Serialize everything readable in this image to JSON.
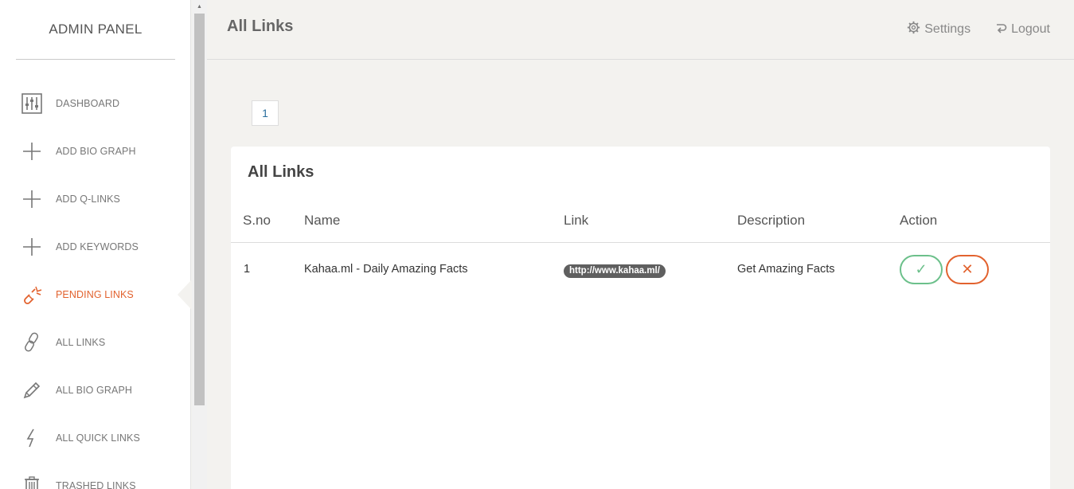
{
  "sidebar": {
    "brand": "ADMIN PANEL",
    "items": [
      {
        "label": "DASHBOARD",
        "icon": "sliders-icon"
      },
      {
        "label": "ADD BIO GRAPH",
        "icon": "plus-icon"
      },
      {
        "label": "ADD Q-LINKS",
        "icon": "plus-icon"
      },
      {
        "label": "ADD KEYWORDS",
        "icon": "plus-icon"
      },
      {
        "label": "PENDING LINKS",
        "icon": "broken-link-icon",
        "active": true
      },
      {
        "label": "ALL LINKS",
        "icon": "link-icon"
      },
      {
        "label": "ALL BIO GRAPH",
        "icon": "pencil-icon"
      },
      {
        "label": "ALL QUICK LINKS",
        "icon": "lightning-icon"
      },
      {
        "label": "TRASHED LINKS",
        "icon": "trash-icon"
      }
    ]
  },
  "header": {
    "title": "All Links",
    "settings_label": "Settings",
    "logout_label": "Logout"
  },
  "pagination": {
    "current_page": "1"
  },
  "table": {
    "title": "All Links",
    "columns": [
      "S.no",
      "Name",
      "Link",
      "Description",
      "Action"
    ],
    "rows": [
      {
        "sno": "1",
        "name": "Kahaa.ml - Daily Amazing Facts",
        "link": "http://www.kahaa.ml/",
        "description": "Get Amazing Facts",
        "approve_icon": "✓",
        "reject_icon": "✕"
      }
    ]
  },
  "colors": {
    "accent": "#e2622e",
    "approve": "#6cc08b",
    "background": "#f3f2ef",
    "link_pill": "#5f5f5f"
  }
}
